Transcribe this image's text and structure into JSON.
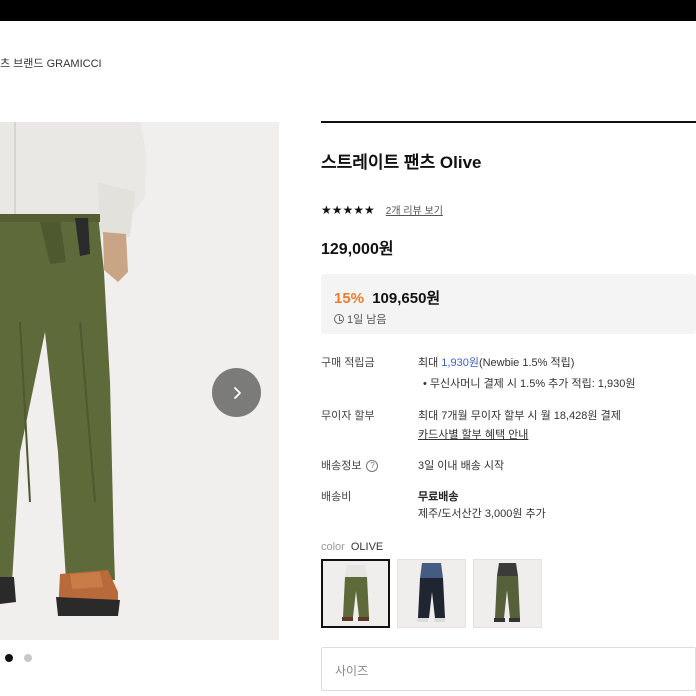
{
  "breadcrumb": "츠 브랜드 GRAMICCI",
  "product": {
    "title": "스트레이트 팬츠 Olive",
    "stars": "★★★★★",
    "review_link": "2개 리뷰 보기",
    "price": "129,000원",
    "sale_rate": "15%",
    "sale_price": "109,650원",
    "sale_timer": "1일 남음"
  },
  "details": {
    "points_label": "구매 적립금",
    "points_prefix": "최대 ",
    "points_amount": "1,930원",
    "points_suffix": "(Newbie 1.5% 적립)",
    "points_bullet": "• 무신사머니 결제 시 1.5% 추가 적립: 1,930원",
    "installment_label": "무이자 할부",
    "installment_value": "최대 7개월 무이자 할부 시 월 18,428원 결제",
    "installment_link": "카드사별 할부 혜택 안내",
    "shipping_info_label": "배송정보",
    "shipping_info_help": "?",
    "shipping_info_value": "3일 이내 배송 시작",
    "shipping_fee_label": "배송비",
    "shipping_fee_value": "무료배송",
    "shipping_fee_extra": "제주/도서산간 3,000원 추가"
  },
  "options": {
    "color_key": "color",
    "color_value": "OLIVE",
    "size_placeholder": "사이즈"
  },
  "gallery": {
    "dots_total": 2,
    "active_dot": 1
  },
  "colors": {
    "sale_orange": "#f07b2c",
    "points_blue": "#3e61c9",
    "olive": "#5f6a3b"
  }
}
